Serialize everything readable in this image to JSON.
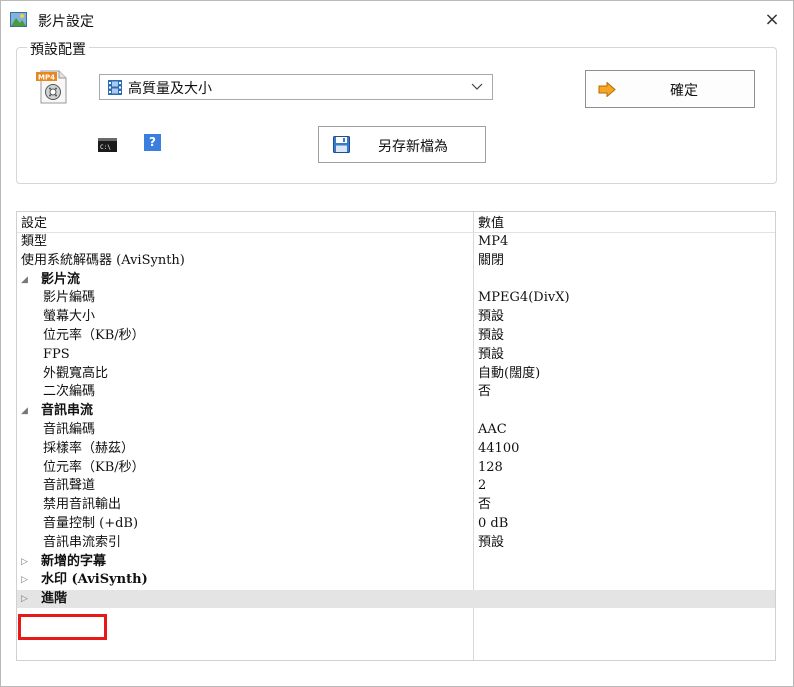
{
  "window": {
    "title": "影片設定",
    "close_glyph": "×"
  },
  "preset": {
    "legend": "預設配置",
    "selected": "高質量及大小",
    "ok_label": "確定",
    "saveas_label": "另存新檔為",
    "help_glyph": "?"
  },
  "grid": {
    "header": {
      "setting": "設定",
      "value": "數值"
    },
    "rows": [
      {
        "k": "類型",
        "v": "MP4",
        "level": 0
      },
      {
        "k": "使用系統解碼器 (AviSynth)",
        "v": "關閉",
        "level": 0
      },
      {
        "k": "影片流",
        "v": "",
        "level": 0,
        "section": true,
        "expanded": true
      },
      {
        "k": "影片編碼",
        "v": "MPEG4(DivX)",
        "level": 1
      },
      {
        "k": "螢幕大小",
        "v": "預設",
        "level": 1
      },
      {
        "k": "位元率（KB/秒）",
        "v": "預設",
        "level": 1
      },
      {
        "k": "FPS",
        "v": "預設",
        "level": 1
      },
      {
        "k": "外觀寬高比",
        "v": "自動(闊度)",
        "level": 1
      },
      {
        "k": "二次編碼",
        "v": "否",
        "level": 1
      },
      {
        "k": "音訊串流",
        "v": "",
        "level": 0,
        "section": true,
        "expanded": true
      },
      {
        "k": "音訊編碼",
        "v": "AAC",
        "level": 1
      },
      {
        "k": "採樣率（赫茲）",
        "v": "44100",
        "level": 1
      },
      {
        "k": "位元率（KB/秒）",
        "v": "128",
        "level": 1
      },
      {
        "k": "音訊聲道",
        "v": "2",
        "level": 1
      },
      {
        "k": "禁用音訊輸出",
        "v": "否",
        "level": 1
      },
      {
        "k": "音量控制 (+dB)",
        "v": "0 dB",
        "level": 1
      },
      {
        "k": "音訊串流索引",
        "v": "預設",
        "level": 1
      },
      {
        "k": "新增的字幕",
        "v": "",
        "level": 0,
        "section": true,
        "expanded": false
      },
      {
        "k": "水印 (AviSynth)",
        "v": "",
        "level": 0,
        "section": true,
        "expanded": false
      },
      {
        "k": "進階",
        "v": "",
        "level": 0,
        "section": true,
        "expanded": false,
        "selected": true
      }
    ]
  },
  "colors": {
    "highlight": "#e81919",
    "accent_orange": "#f5a623",
    "accent_blue": "#3a7fe0"
  },
  "icons": {
    "app": "picture-icon",
    "mp4": "mp4-file-icon",
    "film": "film-icon",
    "ok": "arrow-right-icon",
    "cmd": "command-prompt-icon",
    "help": "help-icon",
    "save": "floppy-disk-icon",
    "dropdown": "chevron-down-icon"
  }
}
